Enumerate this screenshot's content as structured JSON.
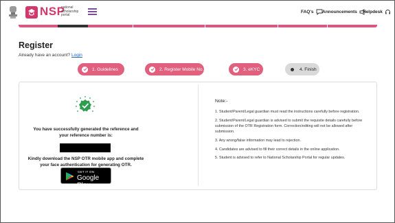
{
  "header": {
    "logo_text": "NSP",
    "logo_subtitle": "national scholarship portal",
    "faqs": "FAQ's",
    "announcements": "Announcements",
    "helpdesk": "Helpdesk"
  },
  "page": {
    "title": "Register",
    "already_text": "Already have an account?",
    "login_link": "Login"
  },
  "steps": [
    {
      "label": "1. Guidelines",
      "state": "done"
    },
    {
      "label": "2. Register Mobile No.",
      "state": "done"
    },
    {
      "label": "3. eKYC",
      "state": "done"
    },
    {
      "label": "4. Finish",
      "state": "active"
    }
  ],
  "left": {
    "success_message": "You have successfully generated the reference and your reference number is:",
    "download_message": "Kindly download the NSP OTR mobile app and complete your face authentication for generating OTR.",
    "gplay_small": "GET IT ON",
    "gplay_big": "Google Play"
  },
  "notes": {
    "title": "Note:-",
    "items": [
      "1. Student/Parent/Legal guardian must read the instructions carefully before registration.",
      "2. Student/Parent/Legal guardian is advised to submit the requisite details carefully before submission of the OTR Registration form. Correction/editing will not be allowed after submission.",
      "3. Any wrong/false information may lead to rejection.",
      "4. Candidates are advised to fill their correct details in the online application.",
      "5. Student is advised to refer to National Scholarship Portal for regular updates."
    ]
  },
  "colors": {
    "brand": "#d2386c",
    "step_done": "#e0607e",
    "step_active": "#d9d9d9",
    "success": "#2e9d4f",
    "link": "#1f63c4"
  }
}
